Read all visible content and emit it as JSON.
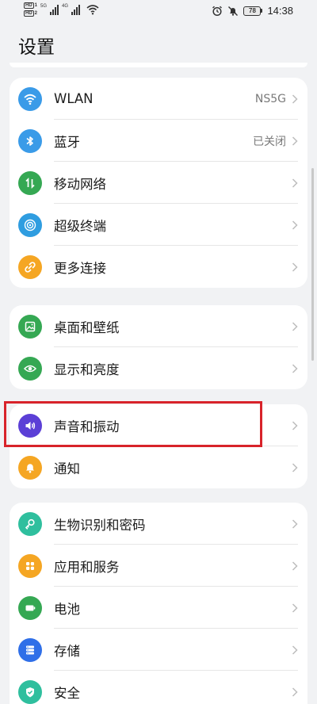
{
  "status_bar": {
    "sim1_tag": "HD",
    "sim1_num": "1",
    "sim2_tag": "HD",
    "sim2_num": "2",
    "net1": "5G",
    "net2": "4G",
    "battery": "78",
    "time": "14:38"
  },
  "header": {
    "title": "设置"
  },
  "groups": [
    {
      "items": [
        {
          "label": "WLAN",
          "value": "NS5G",
          "icon": "wifi-icon",
          "color": "#3a9be8"
        },
        {
          "label": "蓝牙",
          "value": "已关闭",
          "icon": "bluetooth-icon",
          "color": "#3a9be8"
        },
        {
          "label": "移动网络",
          "value": "",
          "icon": "mobile-data-icon",
          "color": "#35a853"
        },
        {
          "label": "超级终端",
          "value": "",
          "icon": "super-device-icon",
          "color": "#2f9de0"
        },
        {
          "label": "更多连接",
          "value": "",
          "icon": "link-icon",
          "color": "#f5a623"
        }
      ]
    },
    {
      "items": [
        {
          "label": "桌面和壁纸",
          "value": "",
          "icon": "wallpaper-icon",
          "color": "#35a853"
        },
        {
          "label": "显示和亮度",
          "value": "",
          "icon": "eye-icon",
          "color": "#35a853"
        }
      ]
    },
    {
      "items": [
        {
          "label": "声音和振动",
          "value": "",
          "icon": "speaker-icon",
          "color": "#5b3fd6"
        },
        {
          "label": "通知",
          "value": "",
          "icon": "bell-icon",
          "color": "#f5a623"
        }
      ]
    },
    {
      "items": [
        {
          "label": "生物识别和密码",
          "value": "",
          "icon": "key-icon",
          "color": "#2fbf9e"
        },
        {
          "label": "应用和服务",
          "value": "",
          "icon": "apps-icon",
          "color": "#f5a623"
        },
        {
          "label": "电池",
          "value": "",
          "icon": "battery-icon",
          "color": "#35a853"
        },
        {
          "label": "存储",
          "value": "",
          "icon": "storage-icon",
          "color": "#2f6fe8"
        },
        {
          "label": "安全",
          "value": "",
          "icon": "shield-icon",
          "color": "#2fbf9e"
        }
      ]
    }
  ],
  "colors": {
    "background": "#f1f2f4",
    "highlight": "#d8232a"
  }
}
